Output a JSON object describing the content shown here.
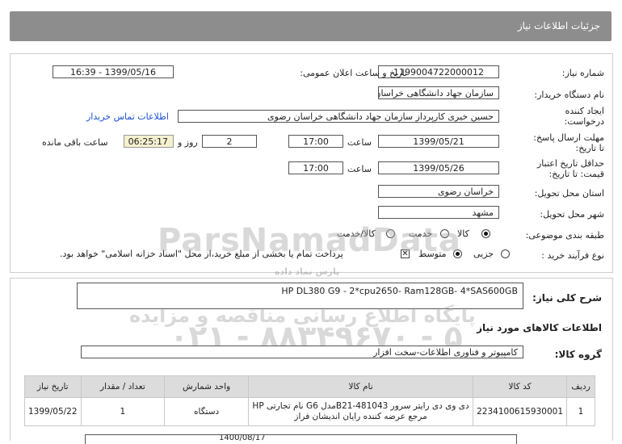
{
  "page": {
    "title": "جزئیات اطلاعات نیاز"
  },
  "form": {
    "need_number_label": "شماره نیاز:",
    "need_number": "1199004722000012",
    "announce_label": "تاریخ و ساعت اعلان عمومی:",
    "announce_value": "1399/05/16 - 16:39",
    "buyer_org_label": "نام دستگاه خریدار:",
    "buyer_org": "سازمان جهاد دانشگاهی خراسان رضوی",
    "creator_label_1": "ایجاد کننده",
    "creator_label_2": "درخواست:",
    "creator": "حسین خیری کارپرداز سازمان جهاد دانشگاهی خراسان رضوی",
    "contact_link": "اطلاعات تماس خریدار",
    "reply_deadline_label_1": "مهلت ارسال پاسخ:",
    "reply_deadline_label_2": "تا تاریخ:",
    "reply_date": "1399/05/21",
    "time_label": "ساعت",
    "reply_time": "17:00",
    "days_value": "2",
    "days_label": "روز و",
    "remaining_time": "06:25:17",
    "remaining_label": "ساعت باقی مانده",
    "validity_label_1": "حداقل تاریخ اعتبار",
    "validity_label_2": "قیمت: تا تاریخ:",
    "validity_date": "1399/05/26",
    "validity_time": "17:00",
    "province_label": "استان محل تحویل:",
    "province": "خراسان رضوی",
    "city_label": "شهر محل تحویل:",
    "city": "مشهد",
    "category_label": "طبقه بندی موضوعی:",
    "category_options": [
      "کالا",
      "خدمت",
      "کالا/خدمت"
    ],
    "category_selected": "کالا",
    "process_label": "نوع فرآیند خرید :",
    "process_options": [
      "جزیی",
      "متوسط"
    ],
    "process_selected": "متوسط",
    "payment_note": "پرداخت تمام یا بخشی از مبلغ خرید،از محل \"اسناد خزانه اسلامی\" خواهد بود."
  },
  "summary": {
    "label": "شرح کلی نیاز:",
    "value": "HP DL380 G9 - 2*cpu2650- Ram128GB- 4*SAS600GB"
  },
  "goods": {
    "section_title": "اطلاعات کالاهای مورد نیاز",
    "group_label": "گروه کالا:",
    "group_value": "کامپیوتر و فناوری اطلاعات-سخت افزار",
    "columns": [
      "ردیف",
      "کد کالا",
      "نام کالا",
      "واحد شمارش",
      "تعداد / مقدار",
      "تاریخ نیاز"
    ],
    "rows": [
      {
        "index": "1",
        "code": "2234100615930001",
        "name_line1": "دی وی دی رایتر سرور B21-481043مدل G6 نام تجارتی HP",
        "name_line2": "مرجع عرضه کننده رایان اندیشان فراز",
        "unit": "دستگاه",
        "qty": "1",
        "date": "1399/05/22"
      }
    ],
    "bottom_partial": "1400/08/17"
  },
  "watermark": {
    "brand": "ParsNamadData",
    "line1": "پایگاه اطلاع رسانی مناقصه و مزایده",
    "phone": "۰۲۱ - ۸۸۳۴۹۶۷۰ - ۵",
    "small": "پارس نماد داده"
  }
}
